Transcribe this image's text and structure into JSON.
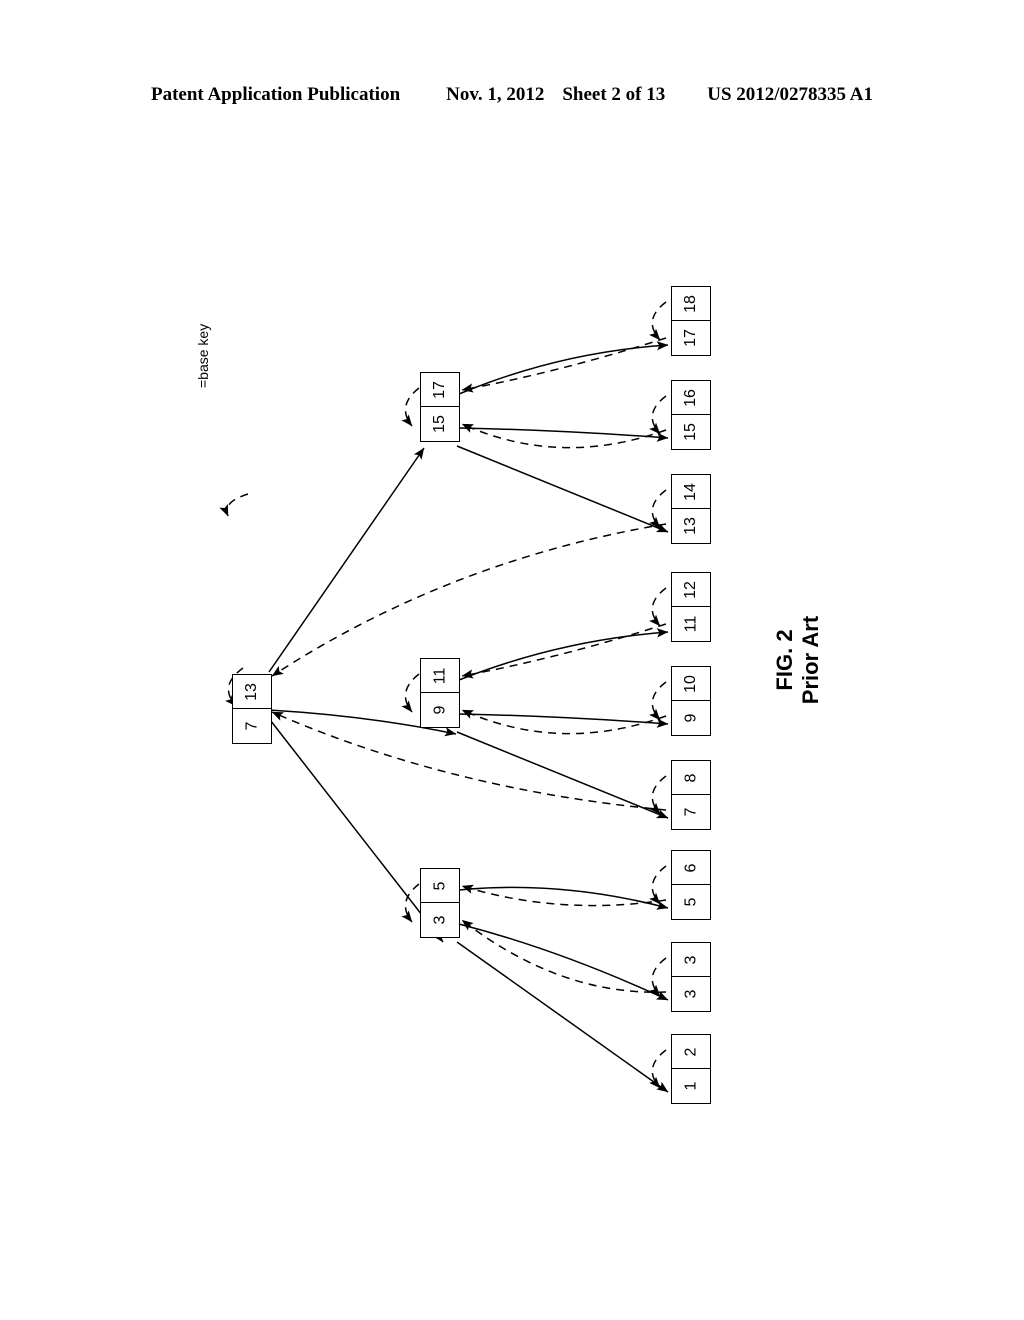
{
  "header": {
    "publication": "Patent Application Publication",
    "date": "Nov. 1, 2012",
    "sheet": "Sheet 2 of 13",
    "doc_number": "US 2012/0278335 A1"
  },
  "caption": {
    "figure": "FIG. 2",
    "subtitle": "Prior Art"
  },
  "legend": {
    "base_key_label": "=base key"
  },
  "colors": {
    "ink": "#000000",
    "paper": "#ffffff"
  },
  "diagram": {
    "type": "b-tree",
    "orientation": "rotated-90",
    "levels": 3,
    "root": {
      "id": "root",
      "cells": [
        "7",
        "13"
      ]
    },
    "internal_nodes": [
      {
        "id": "internal-1",
        "cells": [
          "15",
          "17"
        ]
      },
      {
        "id": "internal-2",
        "cells": [
          "9",
          "11"
        ]
      },
      {
        "id": "internal-3",
        "cells": [
          "3",
          "5"
        ]
      }
    ],
    "leaf_nodes": [
      {
        "id": "leaf-1",
        "cells": [
          "17",
          "18"
        ]
      },
      {
        "id": "leaf-2",
        "cells": [
          "15",
          "16"
        ]
      },
      {
        "id": "leaf-3",
        "cells": [
          "13",
          "14"
        ]
      },
      {
        "id": "leaf-4",
        "cells": [
          "11",
          "12"
        ]
      },
      {
        "id": "leaf-5",
        "cells": [
          "9",
          "10"
        ]
      },
      {
        "id": "leaf-6",
        "cells": [
          "7",
          "8"
        ]
      },
      {
        "id": "leaf-7",
        "cells": [
          "5",
          "6"
        ]
      },
      {
        "id": "leaf-8",
        "cells": [
          "3",
          "3"
        ]
      },
      {
        "id": "leaf-9",
        "cells": [
          "1",
          "2"
        ]
      }
    ]
  }
}
